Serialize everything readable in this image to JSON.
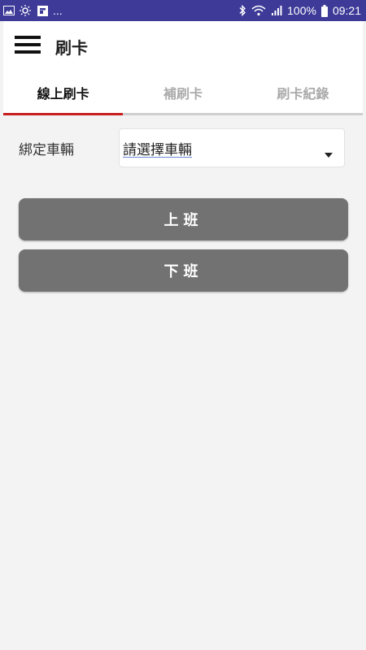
{
  "status_bar": {
    "left_icons": [
      "image-icon",
      "brightness-icon",
      "flipboard-icon"
    ],
    "ellipsis": "...",
    "right_icons": [
      "bluetooth-icon",
      "wifi-icon",
      "signal-icon",
      "battery-icon"
    ],
    "battery": "100%",
    "time": "09:21"
  },
  "app_bar": {
    "menu_icon": "hamburger-menu-icon",
    "title": "刷卡"
  },
  "tabs": [
    {
      "label": "線上刷卡",
      "active": true
    },
    {
      "label": "補刷卡",
      "active": false
    },
    {
      "label": "刷卡紀錄",
      "active": false
    }
  ],
  "form": {
    "vehicle_label": "綁定車輛",
    "vehicle_select_value": "請選擇車輛"
  },
  "buttons": {
    "clock_in": "上班",
    "clock_out": "下班"
  },
  "colors": {
    "status_bar": "#3d3a98",
    "tab_indicator": "#c81e1e",
    "button": "#727272",
    "background": "#f3f3f3"
  }
}
